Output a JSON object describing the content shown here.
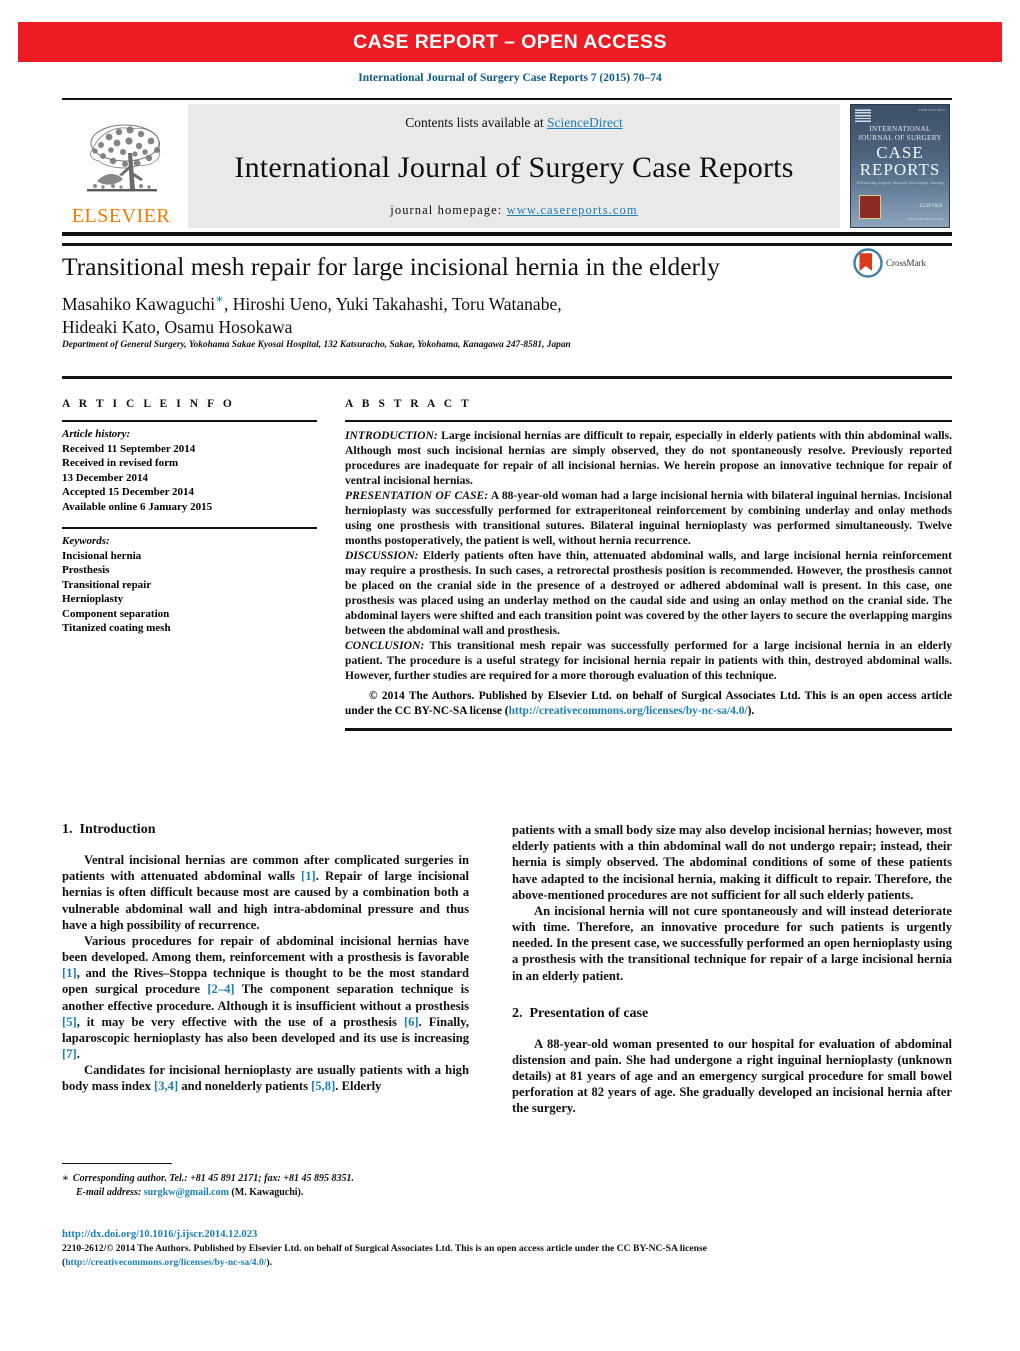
{
  "banner": {
    "text": "CASE REPORT – OPEN ACCESS",
    "color": "#ed1c24"
  },
  "running_head": "International Journal of Surgery Case Reports 7 (2015) 70–74",
  "masthead": {
    "publisher_name": "ELSEVIER",
    "contents_prefix": "Contents lists available at ",
    "contents_link": "ScienceDirect",
    "journal_title": "International Journal of Surgery Case Reports",
    "homepage_prefix": "journal homepage: ",
    "homepage_url": "www.casereports.com",
    "cover": {
      "line1": "INTERNATIONAL",
      "line2": "JOURNAL OF SURGERY",
      "big1": "CASE",
      "big2": "REPORTS",
      "subtitle": "Advancing surgery through knowledge sharing",
      "publisher": "ELSEVIER",
      "url": "www.casereports.com",
      "issn": "ISSN 2210-2612"
    }
  },
  "article": {
    "title": "Transitional mesh repair for large incisional hernia in the elderly",
    "authors_line1": "Masahiko Kawaguchi",
    "authors_line1_rest": ", Hiroshi Ueno, Yuki Takahashi, Toru Watanabe,",
    "authors_line2": "Hideaki Kato, Osamu Hosokawa",
    "corresponding_marker": "∗",
    "affiliation": "Department of General Surgery, Yokohama Sakae Kyosai Hospital, 132 Katsuracho, Sakae, Yokohama, Kanagawa 247-8581, Japan",
    "crossmark_label": "CrossMark"
  },
  "article_info": {
    "heading": "A R T I C L E   I N F O",
    "history_label": "Article history:",
    "history": [
      "Received 11 September 2014",
      "Received in revised form",
      "13 December 2014",
      "Accepted 15 December 2014",
      "Available online 6 January 2015"
    ],
    "keywords_label": "Keywords:",
    "keywords": [
      "Incisional hernia",
      "Prosthesis",
      "Transitional repair",
      "Hernioplasty",
      "Component separation",
      "Titanized coating mesh"
    ]
  },
  "abstract": {
    "heading": "A B S T R A C T",
    "sections": [
      {
        "lead": "INTRODUCTION:",
        "text": " Large incisional hernias are difficult to repair, especially in elderly patients with thin abdominal walls. Although most such incisional hernias are simply observed, they do not spontaneously resolve. Previously reported procedures are inadequate for repair of all incisional hernias. We herein propose an innovative technique for repair of ventral incisional hernias."
      },
      {
        "lead": "PRESENTATION OF CASE:",
        "text": " A 88-year-old woman had a large incisional hernia with bilateral inguinal hernias. Incisional hernioplasty was successfully performed for extraperitoneal reinforcement by combining underlay and onlay methods using one prosthesis with transitional sutures. Bilateral inguinal hernioplasty was performed simultaneously. Twelve months postoperatively, the patient is well, without hernia recurrence."
      },
      {
        "lead": "DISCUSSION:",
        "text": " Elderly patients often have thin, attenuated abdominal walls, and large incisional hernia reinforcement may require a prosthesis. In such cases, a retrorectal prosthesis position is recommended. However, the prosthesis cannot be placed on the cranial side in the presence of a destroyed or adhered abdominal wall is present. In this case, one prosthesis was placed using an underlay method on the caudal side and using an onlay method on the cranial side. The abdominal layers were shifted and each transition point was covered by the other layers to secure the overlapping margins between the abdominal wall and prosthesis."
      },
      {
        "lead": "CONCLUSION:",
        "text": " This transitional mesh repair was successfully performed for a large incisional hernia in an elderly patient. The procedure is a useful strategy for incisional hernia repair in patients with thin, destroyed abdominal walls. However, further studies are required for a more thorough evaluation of this technique."
      }
    ],
    "copyright_pre": "© 2014 The Authors. Published by Elsevier Ltd. on behalf of Surgical Associates Ltd. This is an open access article under the CC BY-NC-SA license (",
    "copyright_link": "http://creativecommons.org/licenses/by-nc-sa/4.0/",
    "copyright_post": ")."
  },
  "body": {
    "left": {
      "heading_num": "1.",
      "heading_text": "Introduction",
      "p1_a": "Ventral incisional hernias are common after complicated surgeries in patients with attenuated abdominal walls ",
      "p1_ref1": "[1]",
      "p1_b": ". Repair of large incisional hernias is often difficult because most are caused by a combination both a vulnerable abdominal wall and high intra-abdominal pressure and thus have a high possibility of recurrence.",
      "p2_a": "Various procedures for repair of abdominal incisional hernias have been developed. Among them, reinforcement with a prosthesis is favorable ",
      "p2_ref1": "[1]",
      "p2_b": ", and the Rives–Stoppa technique is thought to be the most standard open surgical procedure ",
      "p2_ref2": "[2–4]",
      "p2_c": " The component separation technique is another effective procedure. Although it is insufficient without a prosthesis ",
      "p2_ref3": "[5]",
      "p2_d": ", it may be very effective with the use of a prosthesis ",
      "p2_ref4": "[6]",
      "p2_e": ". Finally, laparoscopic hernioplasty has also been developed and its use is increasing ",
      "p2_ref5": "[7]",
      "p2_f": ".",
      "p3_a": "Candidates for incisional hernioplasty are usually patients with a high body mass index ",
      "p3_ref1": "[3,4]",
      "p3_b": " and nonelderly patients ",
      "p3_ref2": "[5,8]",
      "p3_c": ". Elderly"
    },
    "right": {
      "p1": "patients with a small body size may also develop incisional hernias; however, most elderly patients with a thin abdominal wall do not undergo repair; instead, their hernia is simply observed. The abdominal conditions of some of these patients have adapted to the incisional hernia, making it difficult to repair. Therefore, the above-mentioned procedures are not sufficient for all such elderly patients.",
      "p2": "An incisional hernia will not cure spontaneously and will instead deteriorate with time. Therefore, an innovative procedure for such patients is urgently needed. In the present case, we successfully performed an open hernioplasty using a prosthesis with the transitional technique for repair of a large incisional hernia in an elderly patient.",
      "heading_num": "2.",
      "heading_text": "Presentation of case",
      "p3": "A 88-year-old woman presented to our hospital for evaluation of abdominal distension and pain. She had undergone a right inguinal hernioplasty (unknown details) at 81 years of age and an emergency surgical procedure for small bowel perforation at 82 years of age. She gradually developed an incisional hernia after the surgery."
    }
  },
  "footnote": {
    "marker": "∗",
    "corresponding": "Corresponding author. Tel.: +81 45 891 2171; fax: +81 45 895 8351.",
    "email_label": "E-mail address:",
    "email": "surgkw@gmail.com",
    "email_owner": "(M. Kawaguchi)."
  },
  "bottom": {
    "doi": "http://dx.doi.org/10.1016/j.ijscr.2014.12.023",
    "issn_copy": "2210-2612/© 2014 The Authors. Published by Elsevier Ltd. on behalf of Surgical Associates Ltd. This is an open access article under the CC BY-NC-SA license",
    "license_open": "(",
    "license_link": "http://creativecommons.org/licenses/by-nc-sa/4.0/",
    "license_close": ")."
  },
  "colors": {
    "banner_red": "#ed1c24",
    "link_blue": "#1a7fb5",
    "running_head_blue": "#0b5b86",
    "elsevier_orange": "#f07c00",
    "masthead_gray": "#e9e9e9"
  }
}
